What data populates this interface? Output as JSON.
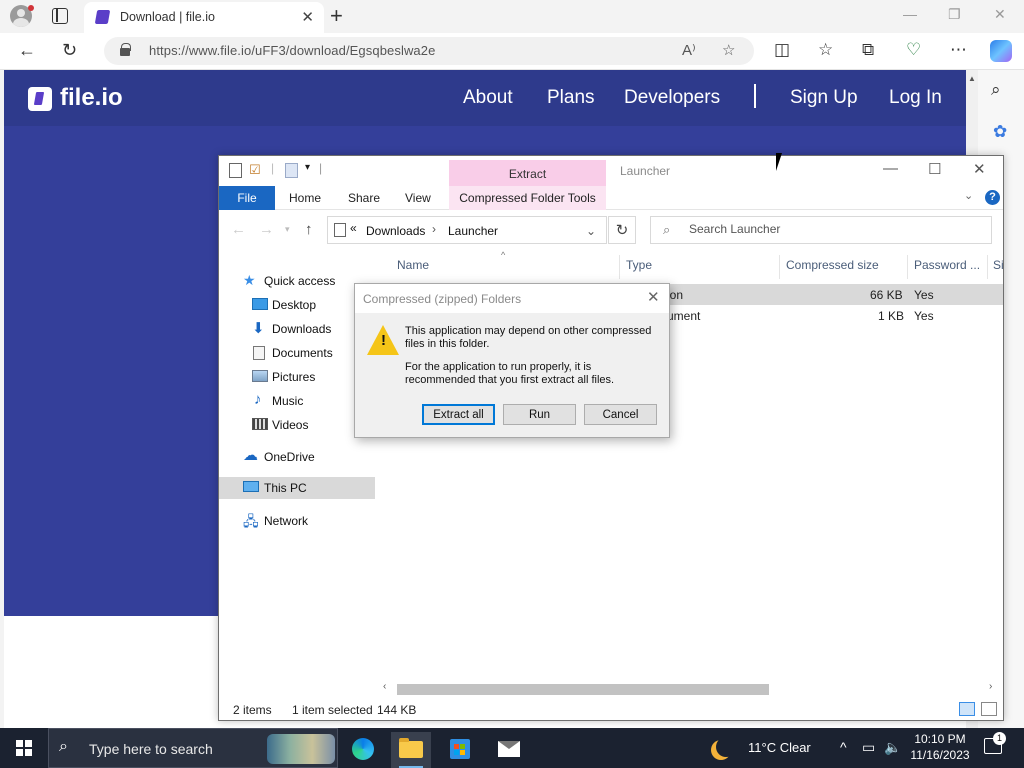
{
  "browser": {
    "tab_title": "Download | file.io",
    "url": "https://www.file.io/uFF3/download/Egsqbeslwa2e",
    "new_tab_glyph": "+",
    "close_glyph": "✕"
  },
  "site": {
    "logo_text": "file.io",
    "nav": {
      "about": "About",
      "plans": "Plans",
      "developers": "Developers",
      "sign_up": "Sign Up",
      "log_in": "Log In"
    },
    "brand_color": "#2e3a8c"
  },
  "explorer": {
    "title": "Launcher",
    "context_tab": "Extract",
    "ribbon": {
      "file": "File",
      "home": "Home",
      "share": "Share",
      "view": "View",
      "context": "Compressed Folder Tools"
    },
    "breadcrumb": {
      "prefix": "«",
      "parts": [
        "Downloads",
        "Launcher"
      ]
    },
    "search_placeholder": "Search Launcher",
    "nav_pane": [
      {
        "label": "Quick access",
        "icon": "star-icon"
      },
      {
        "label": "Desktop",
        "icon": "desktop-icon"
      },
      {
        "label": "Downloads",
        "icon": "download-icon"
      },
      {
        "label": "Documents",
        "icon": "document-icon"
      },
      {
        "label": "Pictures",
        "icon": "pictures-icon"
      },
      {
        "label": "Music",
        "icon": "music-icon"
      },
      {
        "label": "Videos",
        "icon": "videos-icon"
      },
      {
        "label": "OneDrive",
        "icon": "cloud-icon"
      },
      {
        "label": "This PC",
        "icon": "pc-icon"
      },
      {
        "label": "Network",
        "icon": "network-icon"
      }
    ],
    "columns": [
      "Name",
      "Type",
      "Compressed size",
      "Password ...",
      "Si"
    ],
    "rows": [
      {
        "type": "ion",
        "size": "66 KB",
        "password": "Yes"
      },
      {
        "type": "ument",
        "size": "1 KB",
        "password": "Yes"
      }
    ],
    "status": {
      "count": "2 items",
      "selected": "1 item selected",
      "size": "144 KB"
    }
  },
  "dialog": {
    "title": "Compressed (zipped) Folders",
    "message1": "This application may depend on other compressed files in this folder.",
    "message2": "For the application to run properly, it is recommended that you first extract all files.",
    "buttons": {
      "extract": "Extract all",
      "run": "Run",
      "cancel": "Cancel"
    }
  },
  "taskbar": {
    "search_placeholder": "Type here to search",
    "weather": "11°C  Clear",
    "time": "10:10 PM",
    "date": "11/16/2023",
    "notification_count": "1"
  }
}
